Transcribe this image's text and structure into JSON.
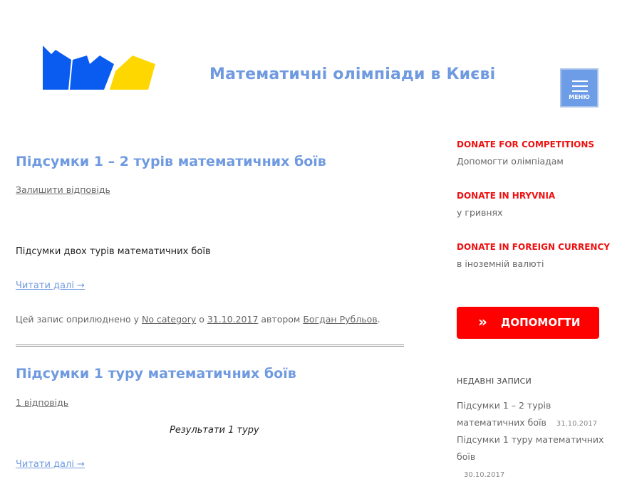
{
  "header": {
    "site_title": "Математичні олімпіади в Києві",
    "menu_label": "МЕНЮ"
  },
  "logo_colors": {
    "blue": "#0a5cf0",
    "yellow": "#ffd700"
  },
  "posts": [
    {
      "title": "Підсумки 1 – 2 турів математичних боїв",
      "comments": "Залишити відповідь",
      "excerpt": "Підсумки двох турів математичних боїв",
      "read_more": "Читати далі →",
      "meta": {
        "prefix": "Цей запис оприлюднено у ",
        "category": "No category",
        "sep1": " о ",
        "date": "31.10.2017",
        "sep2": " автором ",
        "author": "Богдан Рубльов",
        "end": "."
      }
    },
    {
      "title": "Підсумки 1 туру математичних боїв",
      "comments": "1 відповідь",
      "excerpt": "Результати 1 туру",
      "read_more": "Читати далі →"
    }
  ],
  "sidebar": {
    "donate": [
      {
        "heading": "DONATE FOR COMPETITIONS",
        "sub": "Допомогти олімпіадам"
      },
      {
        "heading": "DONATE IN HRYVNIA",
        "sub": "у гривнях"
      },
      {
        "heading": "DONATE IN FOREIGN CURRENCY",
        "sub": "в іноземній валюті"
      }
    ],
    "help_button": "ДОПОМОГТИ",
    "recent_heading": "НЕДАВНІ ЗАПИСИ",
    "recent": [
      {
        "title": "Підсумки 1 – 2 турів математичних боїв",
        "date": "31.10.2017"
      },
      {
        "title": "Підсумки 1 туру математичних боїв",
        "date": "30.10.2017"
      }
    ]
  },
  "colors": {
    "accent": "#6f9ae0",
    "donate_red": "#ee1111",
    "button_red": "#ff0000"
  }
}
